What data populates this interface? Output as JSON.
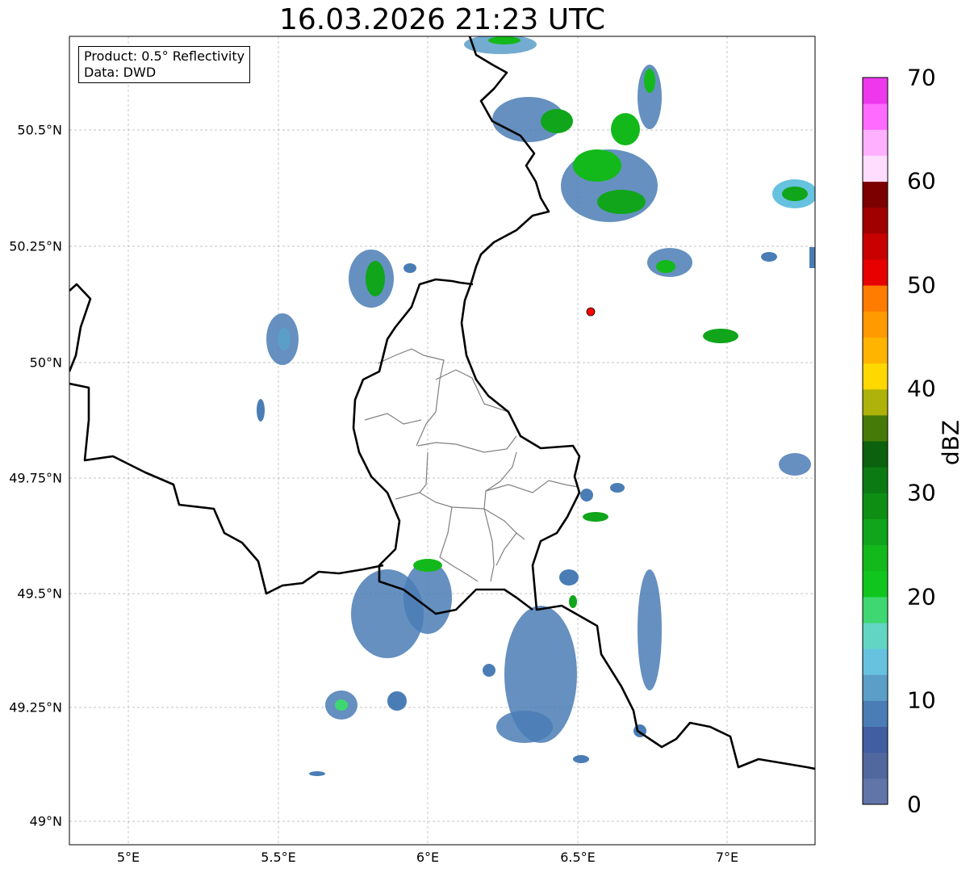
{
  "title": "16.03.2026 21:23 UTC",
  "info": {
    "line1": "Product: 0.5° Reflectivity",
    "line2": "Data: DWD"
  },
  "x_ticks": [
    "5°E",
    "5.5°E",
    "6°E",
    "6.5°E",
    "7°E"
  ],
  "y_ticks": [
    "50.5°N",
    "50.25°N",
    "50°N",
    "49.75°N",
    "49.5°N",
    "49.25°N",
    "49°N"
  ],
  "colorbar": {
    "unit": "dBZ",
    "labels": [
      "0",
      "10",
      "20",
      "30",
      "40",
      "50",
      "60",
      "70"
    ],
    "min": 0,
    "max": 70,
    "colors": [
      "#6175a8",
      "#51689e",
      "#415ea3",
      "#4a7db5",
      "#5b9ec8",
      "#66c2df",
      "#62d6c2",
      "#3ed772",
      "#10c61e",
      "#13b91a",
      "#10a51a",
      "#0e8f14",
      "#0c7a12",
      "#0b610d",
      "#457a08",
      "#aeb20a",
      "#ffd800",
      "#ffb400",
      "#ff9a00",
      "#ff7c00",
      "#e60000",
      "#c80000",
      "#a00000",
      "#7c0000",
      "#ffddff",
      "#ffb1ff",
      "#ff6bff",
      "#ed38ed"
    ]
  },
  "colors": {
    "border": "#000000",
    "admin": "#808080",
    "grid": "#b0b0b0",
    "radar_site": "#ff0000"
  }
}
